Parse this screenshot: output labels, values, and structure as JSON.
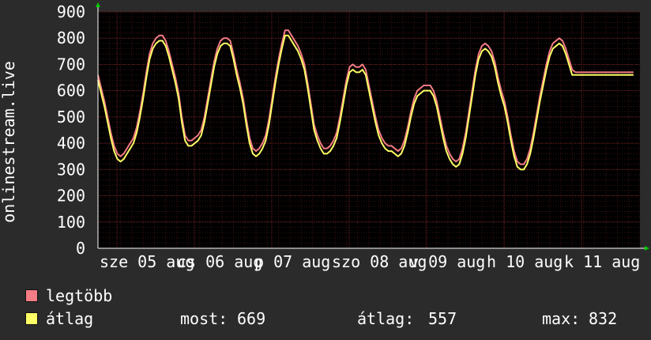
{
  "chart_data": {
    "type": "line",
    "ylabel": "onlinestream.live",
    "ylim": [
      0,
      900
    ],
    "yticks": [
      0,
      100,
      200,
      300,
      400,
      500,
      600,
      700,
      800,
      900
    ],
    "xticklabels": [
      "sze 05 aug",
      "cs 06 aug",
      "p 07 aug",
      "szo 08 aug",
      "v 09 aug",
      "h 10 aug",
      "k 11 aug"
    ],
    "grid": true,
    "colors": {
      "background": "#2b2b2b",
      "plot_bg": "#000000",
      "grid": "#5a1a1a",
      "axis": "#ffffff",
      "legtobb": "#f47c85",
      "atlag": "#ffff66",
      "arrow": "#00cc00"
    },
    "x": [
      0,
      1,
      2,
      3,
      4,
      5,
      6,
      7,
      8,
      9,
      10,
      11,
      12,
      13,
      14,
      15,
      16,
      17,
      18,
      19,
      20,
      21,
      22,
      23,
      24,
      25,
      26,
      27,
      28,
      29,
      30,
      31,
      32,
      33,
      34,
      35,
      36,
      37,
      38,
      39,
      40,
      41,
      42,
      43,
      44,
      45,
      46,
      47,
      48,
      49,
      50,
      51,
      52,
      53,
      54,
      55,
      56,
      57,
      58,
      59,
      60,
      61,
      62,
      63,
      64,
      65,
      66,
      67,
      68,
      69,
      70,
      71,
      72,
      73,
      74,
      75,
      76,
      77,
      78,
      79,
      80,
      81,
      82,
      83,
      84,
      85,
      86,
      87,
      88,
      89,
      90,
      91,
      92,
      93,
      94,
      95,
      96,
      97,
      98,
      99,
      100,
      101,
      102,
      103,
      104,
      105,
      106,
      107,
      108,
      109,
      110,
      111,
      112,
      113,
      114,
      115,
      116,
      117,
      118,
      119,
      120,
      121,
      122,
      123,
      124,
      125,
      126,
      127,
      128,
      129,
      130,
      131,
      132,
      133,
      134,
      135,
      136,
      137,
      138,
      139,
      140,
      141,
      142,
      143,
      144,
      145,
      146,
      147,
      148,
      149,
      150,
      151,
      152,
      153,
      154,
      155,
      156,
      157,
      158,
      159,
      160,
      161,
      162,
      163,
      164,
      165,
      166,
      167,
      168
    ],
    "series": [
      {
        "name": "legtöbb",
        "color": "#f47c85",
        "values": [
          660,
          610,
          560,
          500,
          440,
          390,
          360,
          350,
          360,
          380,
          400,
          420,
          460,
          520,
          590,
          670,
          740,
          780,
          800,
          810,
          810,
          790,
          750,
          700,
          650,
          590,
          500,
          430,
          410,
          410,
          420,
          430,
          450,
          500,
          570,
          640,
          710,
          760,
          790,
          800,
          800,
          790,
          740,
          680,
          630,
          570,
          490,
          420,
          380,
          370,
          380,
          400,
          430,
          490,
          570,
          650,
          720,
          780,
          830,
          830,
          810,
          790,
          770,
          740,
          700,
          630,
          550,
          470,
          430,
          400,
          380,
          380,
          390,
          410,
          440,
          500,
          570,
          640,
          690,
          700,
          690,
          690,
          700,
          680,
          620,
          560,
          500,
          450,
          420,
          400,
          390,
          390,
          380,
          370,
          380,
          410,
          460,
          520,
          570,
          600,
          610,
          620,
          620,
          620,
          600,
          560,
          500,
          440,
          390,
          360,
          340,
          330,
          340,
          380,
          440,
          520,
          600,
          680,
          740,
          770,
          780,
          770,
          750,
          710,
          650,
          600,
          560,
          500,
          430,
          370,
          330,
          320,
          320,
          340,
          380,
          440,
          510,
          580,
          640,
          700,
          750,
          780,
          790,
          800,
          790,
          760,
          720,
          680,
          670,
          670,
          670,
          670,
          670,
          670,
          670,
          670,
          670,
          670,
          670,
          670,
          670,
          670,
          670,
          670,
          670,
          670,
          670
        ]
      },
      {
        "name": "átlag",
        "color": "#ffff66",
        "values": [
          640,
          590,
          540,
          480,
          420,
          370,
          340,
          330,
          340,
          360,
          380,
          400,
          440,
          500,
          570,
          650,
          720,
          760,
          780,
          790,
          790,
          770,
          730,
          680,
          630,
          570,
          480,
          410,
          390,
          390,
          400,
          410,
          430,
          480,
          550,
          620,
          690,
          740,
          770,
          780,
          780,
          770,
          720,
          660,
          610,
          550,
          470,
          400,
          360,
          350,
          360,
          380,
          410,
          470,
          550,
          630,
          700,
          760,
          810,
          810,
          790,
          770,
          750,
          720,
          680,
          610,
          530,
          450,
          410,
          380,
          360,
          360,
          370,
          390,
          420,
          480,
          550,
          620,
          670,
          680,
          670,
          670,
          680,
          660,
          600,
          540,
          480,
          430,
          400,
          380,
          370,
          370,
          360,
          350,
          360,
          390,
          440,
          500,
          550,
          580,
          590,
          600,
          600,
          600,
          580,
          540,
          480,
          420,
          370,
          340,
          320,
          310,
          320,
          360,
          420,
          500,
          580,
          660,
          720,
          750,
          760,
          750,
          730,
          690,
          630,
          580,
          540,
          480,
          410,
          350,
          310,
          300,
          300,
          320,
          360,
          420,
          490,
          560,
          620,
          680,
          730,
          760,
          770,
          780,
          770,
          740,
          700,
          660,
          660,
          660,
          660,
          660,
          660,
          660,
          660,
          660,
          660,
          660,
          660,
          660,
          660,
          660,
          660,
          660,
          660,
          660,
          660
        ]
      }
    ],
    "legend": [
      {
        "label": "legtöbb",
        "color": "#f47c85"
      },
      {
        "label": "átlag",
        "color": "#ffff66"
      }
    ],
    "stats": {
      "most_label": "most:",
      "most": "669",
      "atlag_label": "átlag:",
      "atlag": "557",
      "max_label": "max:",
      "max": "832"
    }
  }
}
